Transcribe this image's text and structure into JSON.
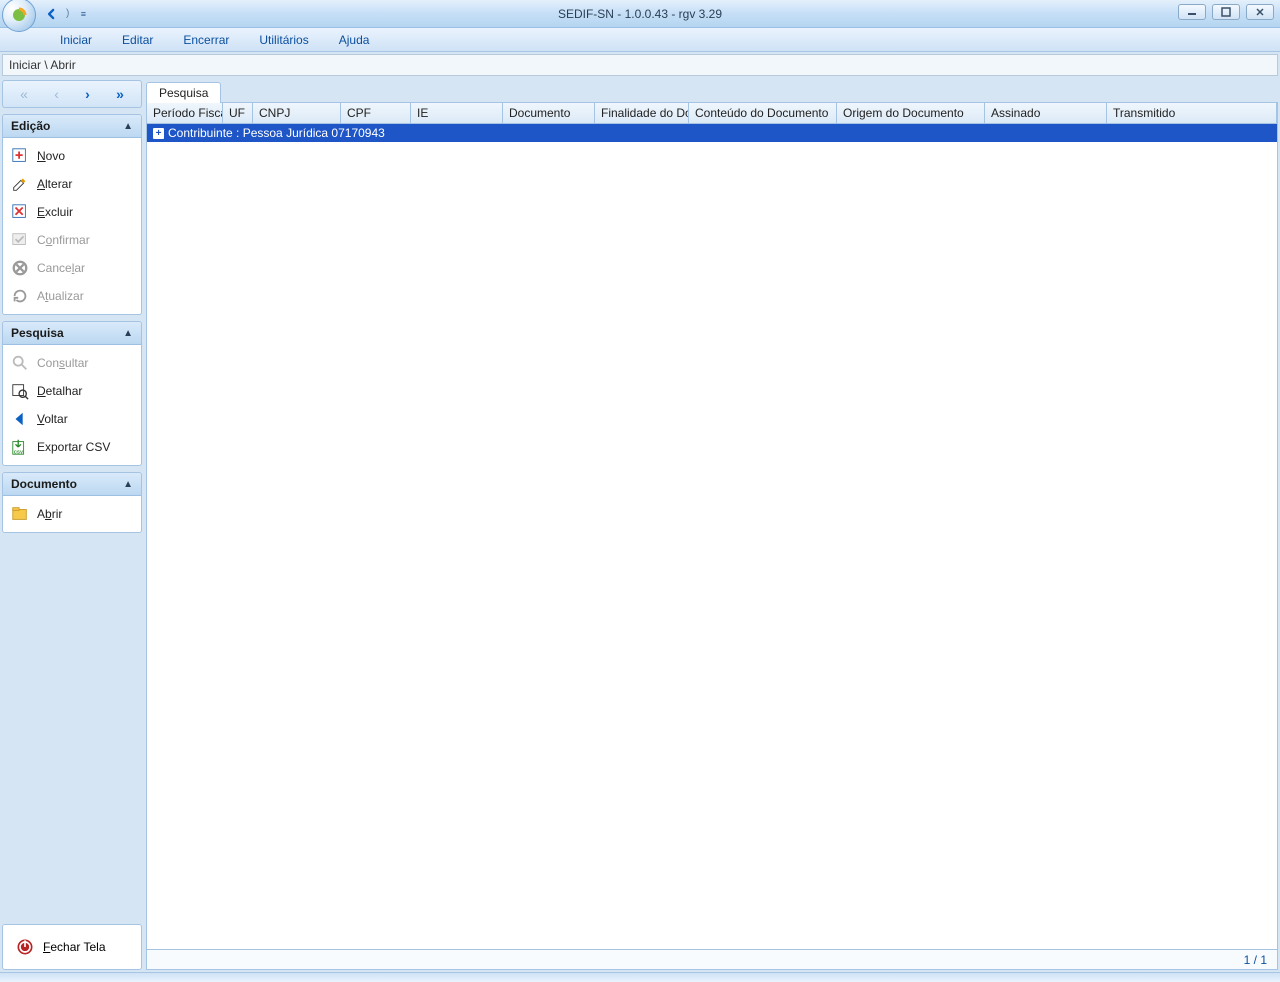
{
  "window": {
    "title": "SEDIF-SN - 1.0.0.43 - rgv 3.29"
  },
  "menu": {
    "iniciar": "Iniciar",
    "editar": "Editar",
    "encerrar": "Encerrar",
    "utilitarios": "Utilitários",
    "ajuda": "Ajuda"
  },
  "breadcrumb": "Iniciar \\ Abrir",
  "sections": {
    "edicao": {
      "title": "Edição",
      "items": {
        "novo": "Novo",
        "alterar": "Alterar",
        "excluir": "Excluir",
        "confirmar": "Confirmar",
        "cancelar": "Cancelar",
        "atualizar": "Atualizar"
      }
    },
    "pesquisa": {
      "title": "Pesquisa",
      "items": {
        "consultar": "Consultar",
        "detalhar": "Detalhar",
        "voltar": "Voltar",
        "exportar": "Exportar CSV"
      }
    },
    "documento": {
      "title": "Documento",
      "items": {
        "abrir": "Abrir"
      }
    }
  },
  "fechar_tela": "Fechar Tela",
  "tab_label": "Pesquisa",
  "grid": {
    "columns": [
      "Período Fiscal",
      "UF",
      "CNPJ",
      "CPF",
      "IE",
      "Documento",
      "Finalidade do Docum",
      "Conteúdo do Documento",
      "Origem do Documento",
      "Assinado",
      "Transmitido"
    ],
    "group_row": "Contribuinte : Pessoa Jurídica 07170943"
  },
  "status": "1 / 1"
}
